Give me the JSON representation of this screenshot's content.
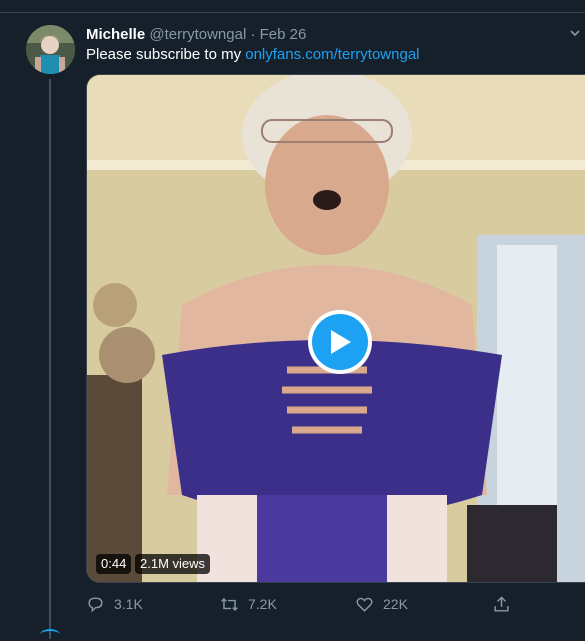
{
  "tweet": {
    "display_name": "Michelle",
    "handle": "@terrytowngal",
    "separator": "·",
    "date": "Feb 26",
    "text": "Please subscribe to my ",
    "link_text": "onlyfans.com/terrytowngal"
  },
  "video": {
    "duration": "0:44",
    "views": "2.1M views"
  },
  "actions": {
    "reply_count": "3.1K",
    "retweet_count": "7.2K",
    "like_count": "22K"
  },
  "colors": {
    "background": "#15202b",
    "accent": "#1da1f2",
    "muted": "#8899a6"
  },
  "icons": [
    "caret-down-icon",
    "play-icon",
    "reply-icon",
    "retweet-icon",
    "like-icon",
    "share-icon"
  ]
}
